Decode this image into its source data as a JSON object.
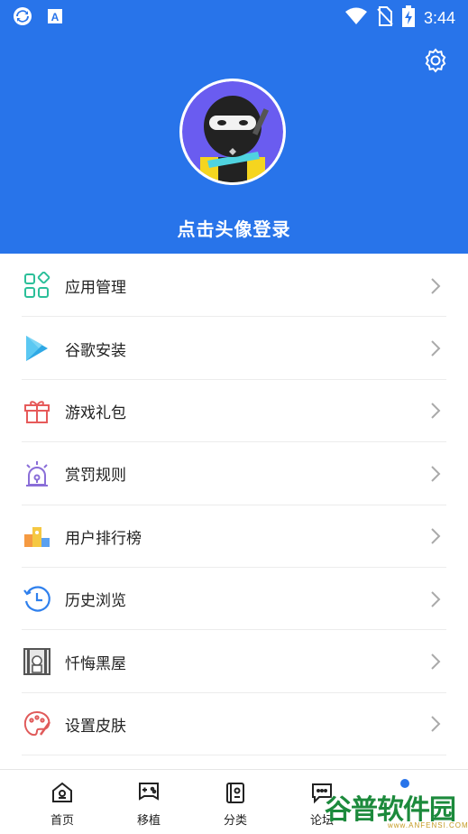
{
  "status_bar": {
    "time": "3:44",
    "icons": [
      "sync-icon",
      "font-a-icon",
      "wifi-icon",
      "no-sim-icon",
      "battery-charging-icon"
    ]
  },
  "header": {
    "login_prompt": "点击头像登录",
    "settings_icon": "gear-icon",
    "avatar_icon": "ninja-avatar",
    "bg_color": "#2874ea"
  },
  "menu": {
    "items": [
      {
        "label": "应用管理",
        "icon": "apps-grid-icon",
        "color": "#2bbf99"
      },
      {
        "label": "谷歌安装",
        "icon": "play-store-icon",
        "color": "#2ea8e5"
      },
      {
        "label": "游戏礼包",
        "icon": "gift-icon",
        "color": "#e65a5a"
      },
      {
        "label": "赏罚规则",
        "icon": "alarm-light-icon",
        "color": "#8a6ed8"
      },
      {
        "label": "用户排行榜",
        "icon": "leaderboard-icon",
        "color": "#f5a623"
      },
      {
        "label": "历史浏览",
        "icon": "history-clock-icon",
        "color": "#2f80ed"
      },
      {
        "label": "忏悔黑屋",
        "icon": "jail-icon",
        "color": "#555555"
      },
      {
        "label": "设置皮肤",
        "icon": "palette-icon",
        "color": "#e05a5a"
      }
    ]
  },
  "bottom_nav": {
    "items": [
      {
        "label": "首页",
        "icon": "home-icon"
      },
      {
        "label": "移植",
        "icon": "gamepad-icon"
      },
      {
        "label": "分类",
        "icon": "category-book-icon"
      },
      {
        "label": "论坛",
        "icon": "chat-icon"
      }
    ]
  },
  "watermark": {
    "text": "谷普软件园",
    "sub": "www.ANFENSI.COM"
  }
}
